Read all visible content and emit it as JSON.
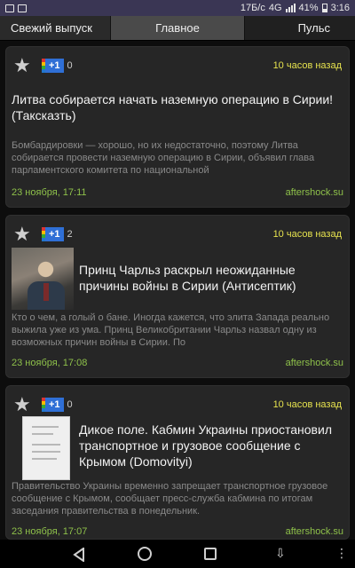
{
  "status_bar": {
    "network": "17Б/с",
    "signal": "4G",
    "battery": "41%",
    "time": "3:16"
  },
  "tabs": [
    "Свежий выпуск",
    "Главное",
    "Пульс"
  ],
  "cards": [
    {
      "plus_label": "+1",
      "plus_count": "0",
      "time_ago": "10 часов назад",
      "title": "Литва собирается начать наземную операцию в Сирии! (Таксказть)",
      "snippet": "Бомбардировки — хорошо, но их недостаточно, поэтому Литва собирается провести наземную операцию в Сирии, объявил глава парламентского комитета по национальной",
      "date": "23 ноября, 17:11",
      "source": "aftershock.su"
    },
    {
      "plus_label": "+1",
      "plus_count": "2",
      "time_ago": "10 часов назад",
      "title": "Принц Чарльз раскрыл неожиданные причины войны в Сирии (Антисептик)",
      "snippet": "Кто о чем, а голый о бане. Иногда кажется, что элита Запада реально выжила уже из ума.  Принц Великобритании Чарльз назвал одну из возможных причин войны в Сирии. По",
      "date": "23 ноября, 17:08",
      "source": "aftershock.su"
    },
    {
      "plus_label": "+1",
      "plus_count": "0",
      "time_ago": "10 часов назад",
      "title": "Дикое поле. Кабмин Украины приостановил транспортное и грузовое сообщение с Крымом (Domovityi)",
      "snippet": "Правительство Украины временно запрещает транспортное грузовое сообщение с Крымом, сообщает пресс-служба кабмина по итогам заседания правительства в понедельник.",
      "date": "23 ноября, 17:07",
      "source": "aftershock.su"
    }
  ],
  "icons": {
    "favorite": "star-icon",
    "plus_one": "google-plus-one-icon",
    "back": "back-icon",
    "home": "home-icon",
    "recents": "recents-icon",
    "notifications": "notification-down-icon",
    "more": "more-icon"
  }
}
